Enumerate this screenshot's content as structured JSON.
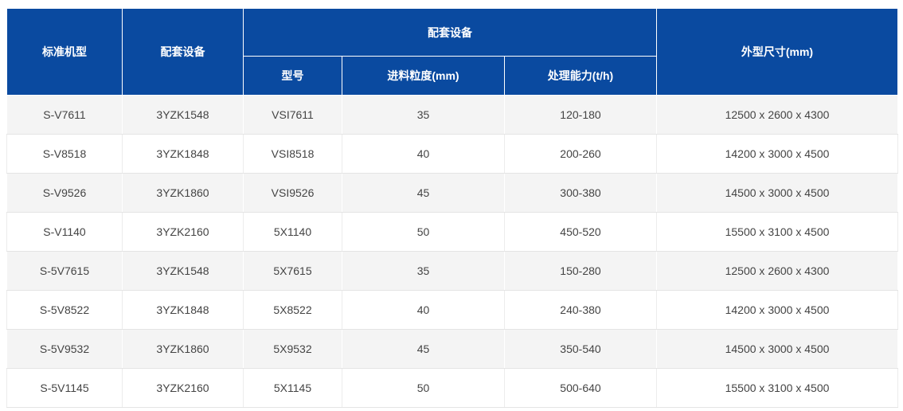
{
  "table": {
    "headers": {
      "col1": "标准机型",
      "col2": "配套设备",
      "group": "配套设备",
      "sub1": "型号",
      "sub2": "进料粒度(mm)",
      "sub3": "处理能力(t/h)",
      "col6": "外型尺寸(mm)"
    },
    "rows": [
      [
        "S-V7611",
        "3YZK1548",
        "VSI7611",
        "35",
        "120-180",
        "12500 x 2600 x 4300"
      ],
      [
        "S-V8518",
        "3YZK1848",
        "VSI8518",
        "40",
        "200-260",
        "14200 x 3000 x 4500"
      ],
      [
        "S-V9526",
        "3YZK1860",
        "VSI9526",
        "45",
        "300-380",
        "14500 x 3000 x 4500"
      ],
      [
        "S-V1140",
        "3YZK2160",
        "5X1140",
        "50",
        "450-520",
        "15500 x 3100 x 4500"
      ],
      [
        "S-5V7615",
        "3YZK1548",
        "5X7615",
        "35",
        "150-280",
        "12500 x 2600 x 4300"
      ],
      [
        "S-5V8522",
        "3YZK1848",
        "5X8522",
        "40",
        "240-380",
        "14200 x 3000 x 4500"
      ],
      [
        "S-5V9532",
        "3YZK1860",
        "5X9532",
        "45",
        "350-540",
        "14500 x 3000 x 4500"
      ],
      [
        "S-5V1145",
        "3YZK2160",
        "5X1145",
        "50",
        "500-640",
        "15500 x 3100 x 4500"
      ]
    ]
  },
  "colors": {
    "header_bg": "#0a4aa0",
    "odd_row_bg": "#f4f4f4",
    "even_row_bg": "#ffffff",
    "text": "#444444"
  }
}
